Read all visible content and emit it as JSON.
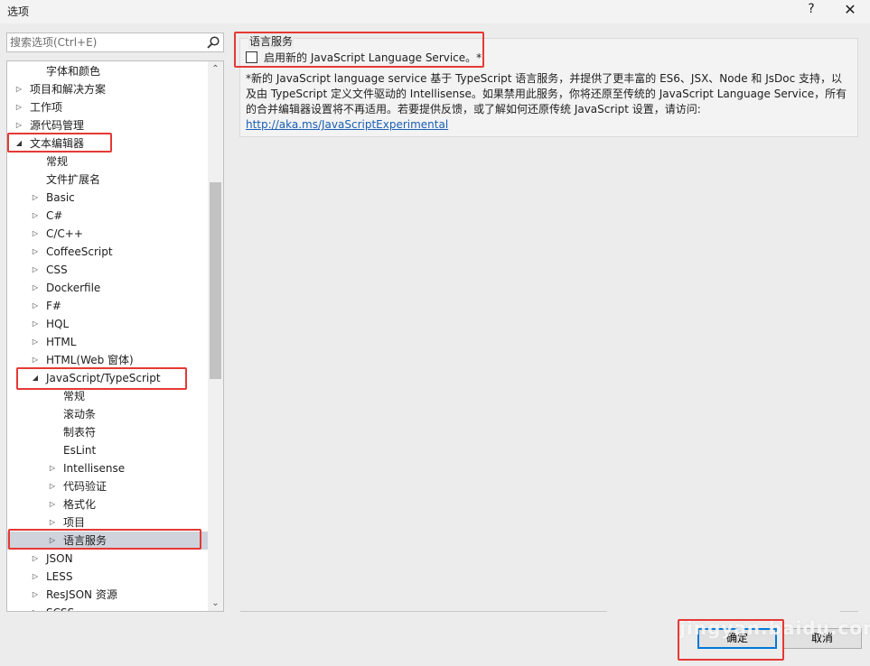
{
  "window": {
    "title": "选项",
    "help": "?",
    "close": "✕"
  },
  "search": {
    "placeholder": "搜索选项(Ctrl+E)",
    "icon": "search-icon"
  },
  "tree": {
    "items": [
      {
        "label": "字体和颜色",
        "level": 2,
        "arrow": ""
      },
      {
        "label": "项目和解决方案",
        "level": 1,
        "arrow": "▷"
      },
      {
        "label": "工作项",
        "level": 1,
        "arrow": "▷"
      },
      {
        "label": "源代码管理",
        "level": 1,
        "arrow": "▷"
      },
      {
        "label": "文本编辑器",
        "level": 1,
        "arrow": "◢"
      },
      {
        "label": "常规",
        "level": 2,
        "arrow": ""
      },
      {
        "label": "文件扩展名",
        "level": 2,
        "arrow": ""
      },
      {
        "label": "Basic",
        "level": 2,
        "arrow": "▷"
      },
      {
        "label": "C#",
        "level": 2,
        "arrow": "▷"
      },
      {
        "label": "C/C++",
        "level": 2,
        "arrow": "▷"
      },
      {
        "label": "CoffeeScript",
        "level": 2,
        "arrow": "▷"
      },
      {
        "label": "CSS",
        "level": 2,
        "arrow": "▷"
      },
      {
        "label": "Dockerfile",
        "level": 2,
        "arrow": "▷"
      },
      {
        "label": "F#",
        "level": 2,
        "arrow": "▷"
      },
      {
        "label": "HQL",
        "level": 2,
        "arrow": "▷"
      },
      {
        "label": "HTML",
        "level": 2,
        "arrow": "▷"
      },
      {
        "label": "HTML(Web 窗体)",
        "level": 2,
        "arrow": "▷"
      },
      {
        "label": "JavaScript/TypeScript",
        "level": 2,
        "arrow": "◢"
      },
      {
        "label": "常规",
        "level": 3,
        "arrow": ""
      },
      {
        "label": "滚动条",
        "level": 3,
        "arrow": ""
      },
      {
        "label": "制表符",
        "level": 3,
        "arrow": ""
      },
      {
        "label": "EsLint",
        "level": 3,
        "arrow": ""
      },
      {
        "label": "Intellisense",
        "level": 3,
        "arrow": "▷"
      },
      {
        "label": "代码验证",
        "level": 3,
        "arrow": "▷"
      },
      {
        "label": "格式化",
        "level": 3,
        "arrow": "▷"
      },
      {
        "label": "项目",
        "level": 3,
        "arrow": "▷"
      },
      {
        "label": "语言服务",
        "level": 3,
        "arrow": "▷",
        "selected": true
      },
      {
        "label": "JSON",
        "level": 2,
        "arrow": "▷"
      },
      {
        "label": "LESS",
        "level": 2,
        "arrow": "▷"
      },
      {
        "label": "ResJSON 资源",
        "level": 2,
        "arrow": "▷"
      },
      {
        "label": "SCSS",
        "level": 2,
        "arrow": "▷"
      }
    ],
    "scroll_up": "⌃",
    "scroll_down": "⌄"
  },
  "panel": {
    "group_title": "语言服务",
    "checkbox_label": "启用新的 JavaScript Language Service。*",
    "checkbox_checked": false,
    "description": "*新的 JavaScript language service 基于 TypeScript 语言服务，并提供了更丰富的 ES6、JSX、Node 和 JsDoc 支持，以及由 TypeScript 定义文件驱动的 Intellisense。如果禁用此服务，你将还原至传统的 JavaScript Language Service，所有的合并编辑器设置将不再适用。若要提供反馈，或了解如何还原传统 JavaScript 设置，请访问: ",
    "link": "http://aka.ms/JavaScriptExperimental"
  },
  "buttons": {
    "ok": "确定",
    "cancel": "取消"
  },
  "watermark": "jingyan.baidu.com",
  "colors": {
    "annotation": "#e53935",
    "selected_bg": "#cfd3dc",
    "link": "#1a5fb4"
  }
}
